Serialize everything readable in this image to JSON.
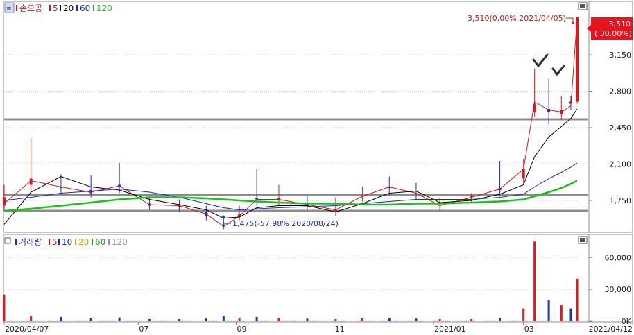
{
  "price_legend": {
    "name": "손오공",
    "ma": [
      "5",
      "20",
      "60",
      "120"
    ]
  },
  "volume_legend": {
    "name": "거래량",
    "ma": [
      "5",
      "10",
      "20",
      "60",
      "120"
    ]
  },
  "price_axis": {
    "ticks": [
      "3,150",
      "2,800",
      "2,450",
      "2,100",
      "1,750"
    ]
  },
  "volume_axis": {
    "ticks": [
      "60,000",
      "30,000",
      "0K"
    ]
  },
  "current_price": {
    "value": "3,510",
    "change": "( 30.00%)"
  },
  "annotations": {
    "high": "3,510(0.00% 2021/04/05)",
    "low": "1,475(-57.98% 2020/08/24)"
  },
  "date_labels": [
    "2020/04/07",
    "07",
    "09",
    "11",
    "2021/01",
    "03",
    "2021/04/12"
  ],
  "colors": {
    "up": "#e8141b",
    "down": "#1c2fc4",
    "ma5": "#d01818",
    "ma20": "#000000",
    "ma60": "#1a2ab8",
    "ma120": "#19c219",
    "support": "#8c8c8c"
  },
  "chart_data": [
    {
      "type": "candlestick",
      "title": "손오공",
      "ylim": [
        1450,
        3650
      ],
      "x_range": [
        "2020-04-07",
        "2021-04-12"
      ],
      "series": [
        {
          "name": "5",
          "x": [
            "2020-04-07",
            "2020-04-24",
            "2020-05-13",
            "2020-06-01",
            "2020-06-19",
            "2020-07-08",
            "2020-07-27",
            "2020-08-13",
            "2020-08-24",
            "2020-09-03",
            "2020-09-14",
            "2020-09-28",
            "2020-10-16",
            "2020-11-03",
            "2020-11-20",
            "2020-12-07",
            "2020-12-24",
            "2021-01-08",
            "2021-01-28",
            "2021-02-15",
            "2021-03-02",
            "2021-03-09",
            "2021-03-18",
            "2021-03-26",
            "2021-04-01",
            "2021-04-05"
          ],
          "values": [
            1720,
            1940,
            1880,
            1830,
            1890,
            1710,
            1700,
            1620,
            1500,
            1600,
            1760,
            1760,
            1710,
            1660,
            1790,
            1880,
            1820,
            1700,
            1780,
            1860,
            2050,
            2700,
            2620,
            2600,
            2660,
            3510
          ]
        },
        {
          "name": "20",
          "x": [
            "2020-04-07",
            "2020-04-24",
            "2020-05-13",
            "2020-06-01",
            "2020-06-19",
            "2020-07-08",
            "2020-07-27",
            "2020-08-13",
            "2020-08-24",
            "2020-09-03",
            "2020-09-14",
            "2020-09-28",
            "2020-10-16",
            "2020-11-03",
            "2020-11-20",
            "2020-12-07",
            "2020-12-24",
            "2021-01-08",
            "2021-01-28",
            "2021-02-15",
            "2021-03-02",
            "2021-03-09",
            "2021-03-18",
            "2021-03-26",
            "2021-04-01",
            "2021-04-05"
          ],
          "values": [
            1520,
            1830,
            1980,
            1880,
            1850,
            1760,
            1710,
            1660,
            1580,
            1590,
            1680,
            1700,
            1700,
            1640,
            1720,
            1820,
            1840,
            1730,
            1750,
            1810,
            1900,
            2170,
            2360,
            2460,
            2540,
            2630
          ]
        },
        {
          "name": "60",
          "x": [
            "2020-04-07",
            "2020-04-24",
            "2020-05-13",
            "2020-06-01",
            "2020-06-19",
            "2020-07-08",
            "2020-07-27",
            "2020-08-13",
            "2020-08-24",
            "2020-09-03",
            "2020-09-14",
            "2020-09-28",
            "2020-10-16",
            "2020-11-03",
            "2020-11-20",
            "2020-12-07",
            "2020-12-24",
            "2021-01-08",
            "2021-01-28",
            "2021-02-15",
            "2021-03-02",
            "2021-03-09",
            "2021-03-18",
            "2021-03-26",
            "2021-04-01",
            "2021-04-05"
          ],
          "values": [
            1750,
            1780,
            1820,
            1840,
            1860,
            1830,
            1780,
            1720,
            1680,
            1660,
            1670,
            1680,
            1690,
            1700,
            1720,
            1740,
            1760,
            1760,
            1760,
            1780,
            1810,
            1880,
            1960,
            2020,
            2070,
            2110
          ]
        },
        {
          "name": "120",
          "x": [
            "2020-04-07",
            "2020-04-24",
            "2020-05-13",
            "2020-06-01",
            "2020-06-19",
            "2020-07-08",
            "2020-07-27",
            "2020-08-13",
            "2020-08-24",
            "2020-09-03",
            "2020-09-14",
            "2020-09-28",
            "2020-10-16",
            "2020-11-03",
            "2020-11-20",
            "2020-12-07",
            "2020-12-24",
            "2021-01-08",
            "2021-01-28",
            "2021-02-15",
            "2021-03-02",
            "2021-03-09",
            "2021-03-18",
            "2021-03-26",
            "2021-04-01",
            "2021-04-05"
          ],
          "values": [
            1650,
            1670,
            1700,
            1730,
            1760,
            1780,
            1780,
            1770,
            1760,
            1750,
            1740,
            1730,
            1720,
            1720,
            1710,
            1710,
            1720,
            1720,
            1730,
            1740,
            1760,
            1790,
            1830,
            1870,
            1910,
            1940
          ]
        }
      ],
      "candles": {
        "x": [
          "2020-04-07",
          "2020-04-24",
          "2020-05-13",
          "2020-06-01",
          "2020-06-19",
          "2020-07-08",
          "2020-07-27",
          "2020-08-13",
          "2020-08-24",
          "2020-09-03",
          "2020-09-14",
          "2020-09-28",
          "2020-10-16",
          "2020-11-03",
          "2020-11-20",
          "2020-12-07",
          "2020-12-24",
          "2021-01-08",
          "2021-01-28",
          "2021-02-15",
          "2021-03-02",
          "2021-03-09",
          "2021-03-18",
          "2021-03-26",
          "2021-04-01",
          "2021-04-05"
        ],
        "open": [
          1700,
          1900,
          1880,
          1850,
          1900,
          1720,
          1710,
          1640,
          1520,
          1600,
          1770,
          1750,
          1720,
          1650,
          1790,
          1880,
          1820,
          1700,
          1780,
          1870,
          1960,
          2600,
          2630,
          2580,
          2700,
          2700
        ],
        "close": [
          1780,
          1960,
          1870,
          1820,
          1880,
          1700,
          1690,
          1600,
          1500,
          1620,
          1760,
          1770,
          1700,
          1670,
          1800,
          1870,
          1810,
          1710,
          1790,
          1850,
          2050,
          2680,
          2600,
          2620,
          2680,
          3510
        ],
        "high": [
          1900,
          2350,
          2000,
          1990,
          2110,
          1780,
          1760,
          1700,
          1600,
          1700,
          2050,
          1900,
          1800,
          1780,
          1880,
          1980,
          1920,
          1780,
          1820,
          2130,
          2150,
          3020,
          2920,
          2750,
          2750,
          3510
        ],
        "low": [
          1650,
          1850,
          1820,
          1780,
          1820,
          1660,
          1640,
          1560,
          1475,
          1560,
          1700,
          1700,
          1650,
          1600,
          1740,
          1800,
          1760,
          1650,
          1740,
          1790,
          1900,
          2550,
          2480,
          2520,
          2620,
          2680
        ]
      },
      "annotations": [
        {
          "x": "2021-04-05",
          "y": 3510,
          "text": "3,510(0.00% 2021/04/05)"
        },
        {
          "x": "2020-08-24",
          "y": 1475,
          "text": "1,475(-57.98% 2020/08/24)"
        }
      ],
      "horizontal_lines": [
        2530,
        1800,
        1650
      ],
      "yticks": [
        3150,
        2800,
        2450,
        2100,
        1750
      ],
      "current_price": 3510,
      "grid": true
    },
    {
      "type": "bar",
      "title": "거래량",
      "ylim": [
        0,
        70000
      ],
      "yticks": [
        60000,
        30000,
        0
      ],
      "x": [
        "2020-04-07",
        "2020-04-24",
        "2020-05-13",
        "2020-06-01",
        "2020-06-19",
        "2020-07-08",
        "2020-07-27",
        "2020-08-13",
        "2020-08-24",
        "2020-09-03",
        "2020-09-14",
        "2020-09-28",
        "2020-10-16",
        "2020-11-03",
        "2020-11-20",
        "2020-12-07",
        "2020-12-24",
        "2021-01-08",
        "2021-01-28",
        "2021-02-15",
        "2021-03-02",
        "2021-03-09",
        "2021-03-18",
        "2021-03-26",
        "2021-04-01",
        "2021-04-05"
      ],
      "values": [
        25000,
        5000,
        4000,
        3000,
        3500,
        2000,
        2000,
        2500,
        5000,
        3000,
        4000,
        3000,
        2500,
        2000,
        3000,
        3000,
        2500,
        2000,
        2000,
        3000,
        12000,
        75000,
        20000,
        15000,
        12000,
        40000
      ]
    }
  ]
}
